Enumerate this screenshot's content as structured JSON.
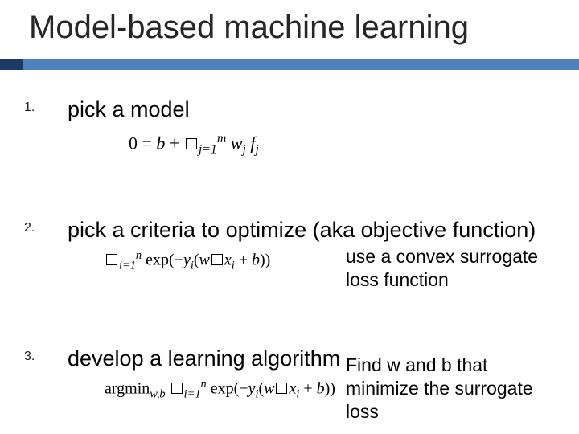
{
  "title": "Model-based machine learning",
  "items": [
    {
      "num": "1.",
      "text": "pick a model",
      "formula_html": "0 = <span class='ital'>b</span> + <span class='sqbox'></span><span class='sub'>j=1</span><span class='sup'>m</span>&nbsp;<span class='ital'>w</span><span class='sub'>j</span>&nbsp;<span class='ital'>f</span><span class='sub'>j</span>"
    },
    {
      "num": "2.",
      "text": "pick a criteria to optimize (aka objective function)",
      "formula_html": "<span class='sqbox'></span><span class='sub'>i=1</span><span class='sup'>n</span>&nbsp;exp(&minus;<span class='ital'>y</span><span class='sub'>i</span>(<span class='ital'>w</span><span class='sqbox'></span><span class='ital'>x</span><span class='sub'>i</span> + <span class='ital'>b</span>))",
      "note": "use a convex surrogate loss function"
    },
    {
      "num": "3.",
      "text": "develop a learning algorithm",
      "formula_html": "argmin<span class='sub'>w,b</span>&nbsp;<span class='sqbox'></span><span class='sub'>i=1</span><span class='sup'>n</span>&nbsp;exp(&minus;<span class='ital'>y</span><span class='sub'>i</span>(<span class='ital'>w</span><span class='sqbox'></span><span class='ital'>x</span><span class='sub'>i</span> + <span class='ital'>b</span>))",
      "note": "Find w and b that minimize the surrogate loss"
    }
  ]
}
